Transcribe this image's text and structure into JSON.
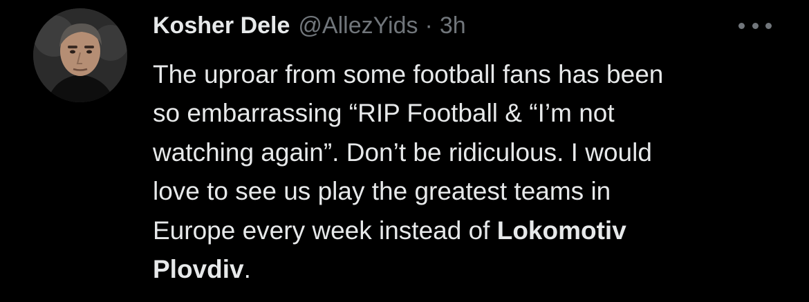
{
  "tweet": {
    "author": {
      "display_name": "Kosher Dele",
      "handle": "@AllezYids",
      "avatar_icon": "user-avatar-photo"
    },
    "separator": "·",
    "timestamp": "3h",
    "more_icon": "more-horizontal-icon",
    "lines": [
      "The uproar from some football fans has been",
      "so embarrassing “RIP Football & “I’m not",
      "watching again”. Don’t be ridiculous. I would",
      "love to see us play the greatest teams in"
    ],
    "line5_plain": "Europe every week instead of ",
    "line5_bold": "Lokomotiv",
    "line6_bold": "Plovdiv",
    "line6_plain": "."
  },
  "colors": {
    "background": "#000000",
    "primary_text": "#e7e9ea",
    "secondary_text": "#71767b"
  }
}
